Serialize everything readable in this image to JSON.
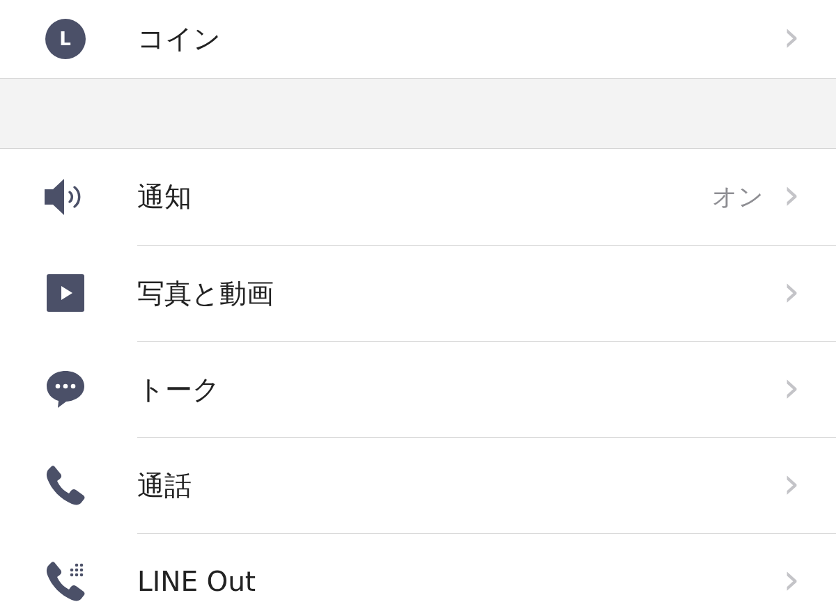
{
  "sections": [
    {
      "items": [
        {
          "kind": "coin",
          "icon_text": "L",
          "label": "コイン"
        }
      ]
    },
    {
      "items": [
        {
          "kind": "speaker",
          "label": "通知",
          "value": "オン"
        },
        {
          "kind": "video",
          "label": "写真と動画"
        },
        {
          "kind": "chat",
          "label": "トーク"
        },
        {
          "kind": "phone",
          "label": "通話"
        },
        {
          "kind": "phone-dots",
          "label": "LINE Out"
        }
      ]
    }
  ],
  "chevron": "›"
}
